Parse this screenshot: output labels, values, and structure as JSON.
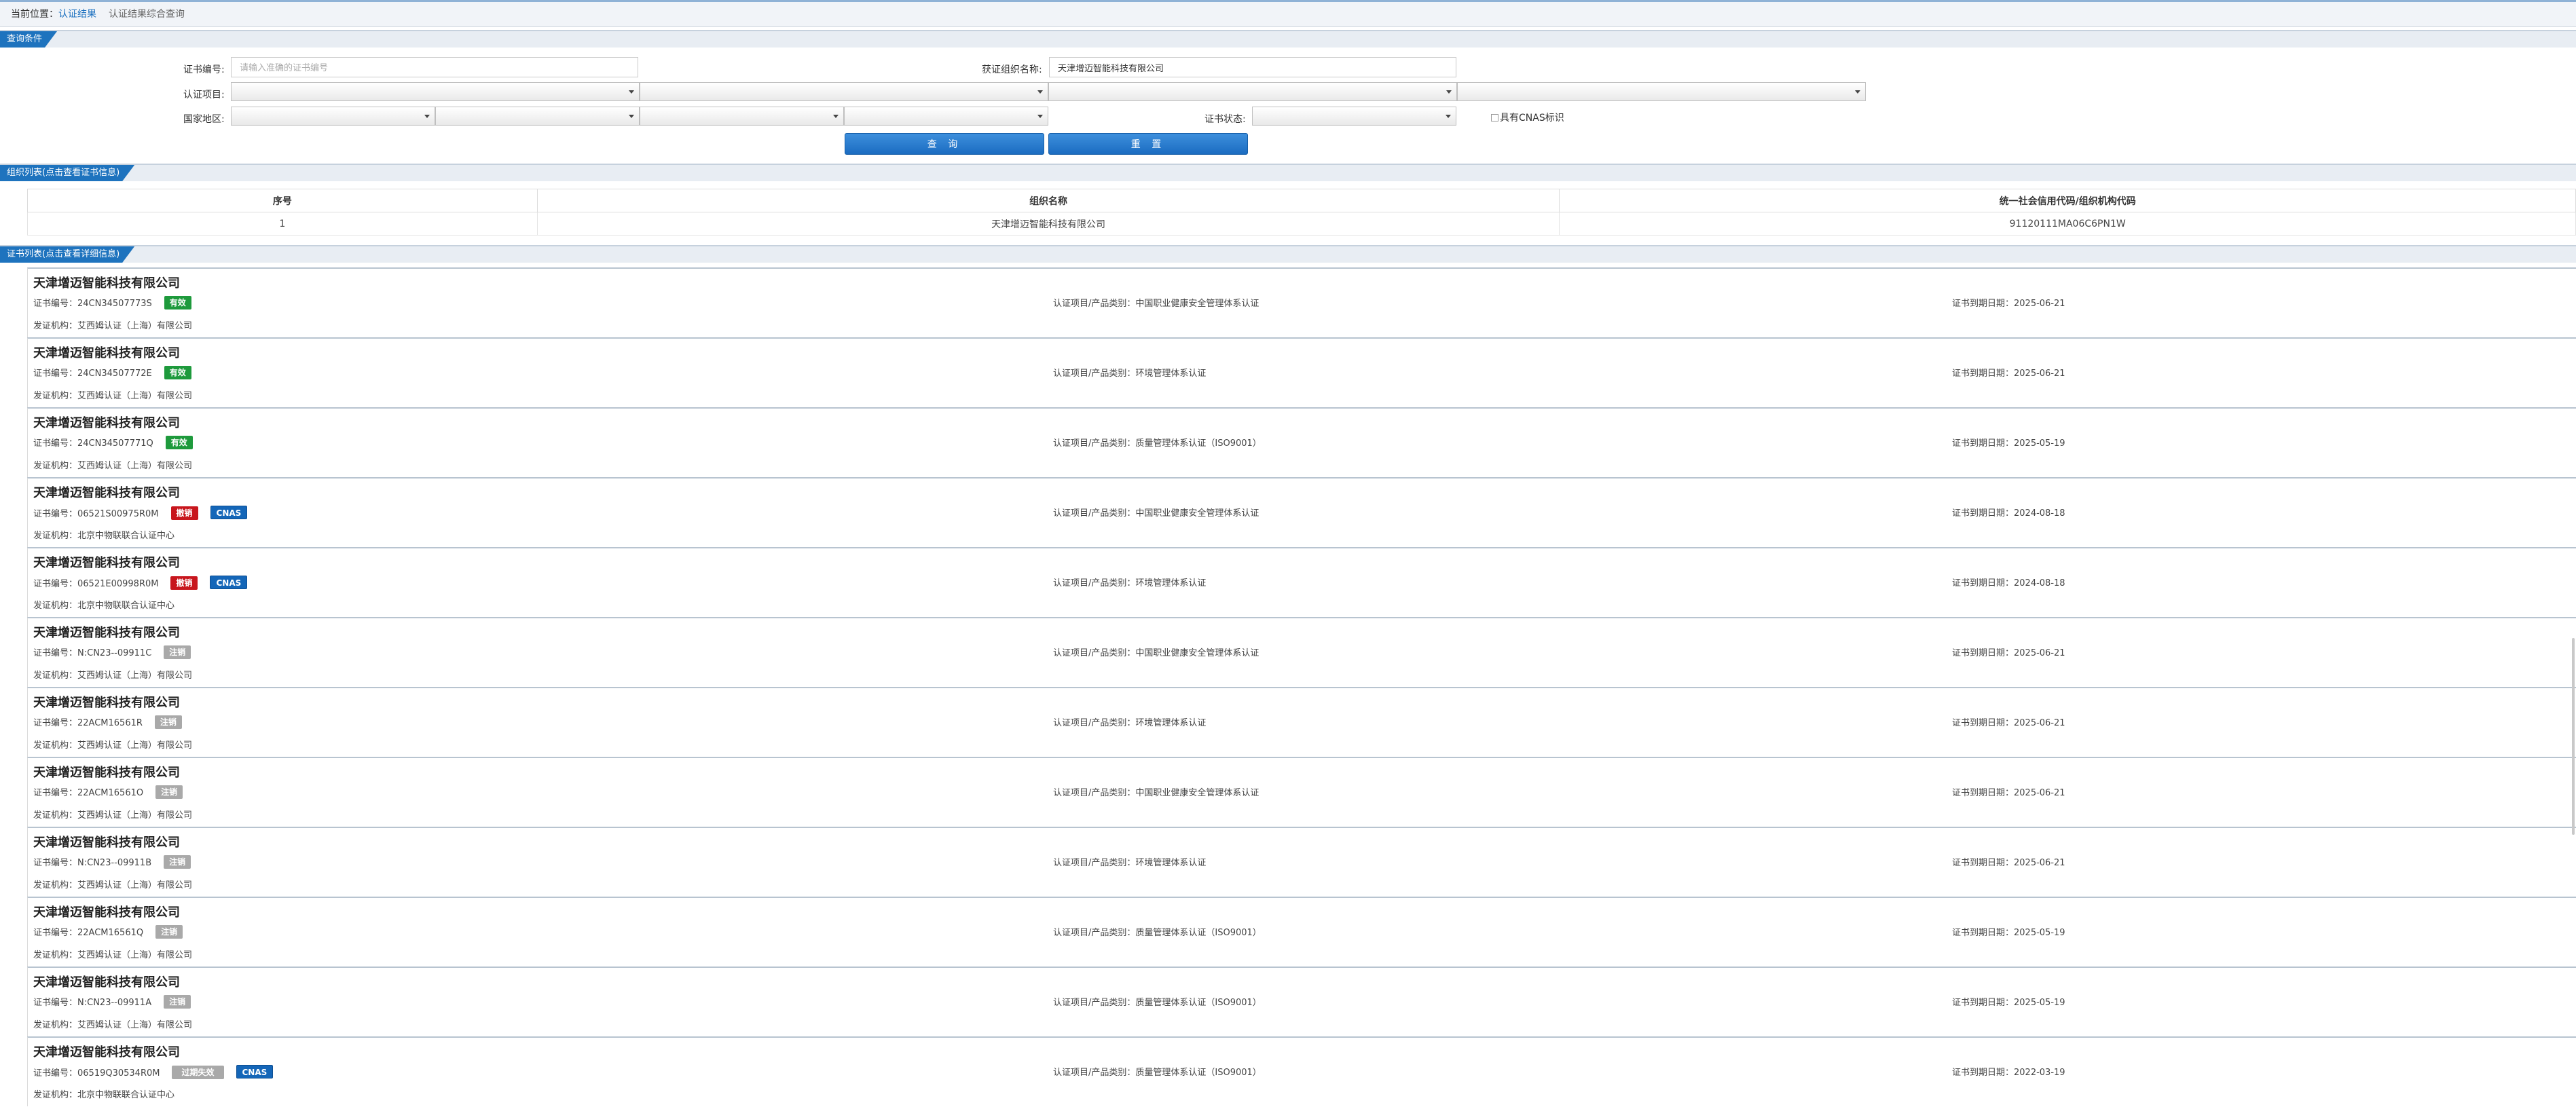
{
  "breadcrumb": {
    "prefix": "当前位置：",
    "current": "认证结果",
    "sub": "认证结果综合查询"
  },
  "query_section": {
    "title": "查询条件"
  },
  "form": {
    "cert_no_label": "证书编号:",
    "cert_no_placeholder": "请输入准确的证书编号",
    "org_name_label": "获证组织名称:",
    "org_name_value": "天津增迈智能科技有限公司",
    "project_label": "认证项目:",
    "region_label": "国家地区:",
    "status_label": "证书状态:",
    "cnas_label": "具有CNAS标识"
  },
  "buttons": {
    "search": "查 询",
    "reset": "重 置"
  },
  "org_section": {
    "title": "组织列表(点击查看证书信息)"
  },
  "org_table": {
    "headers": [
      "序号",
      "组织名称",
      "统一社会信用代码/组织机构代码"
    ],
    "rows": [
      [
        "1",
        "天津增迈智能科技有限公司",
        "91120111MA06C6PN1W"
      ]
    ]
  },
  "cert_section": {
    "title": "证书列表(点击查看详细信息)"
  },
  "cert_labels": {
    "no": "证书编号：",
    "issuer": "发证机构：",
    "project": "认证项目/产品类别：",
    "expiry": "证书到期日期："
  },
  "certs": [
    {
      "name": "天津增迈智能科技有限公司",
      "no": "24CN34507773S",
      "status": "有效",
      "status_type": "valid",
      "cnas": "",
      "issuer": "艾西姆认证（上海）有限公司",
      "project": "中国职业健康安全管理体系认证",
      "expiry": "2025-06-21"
    },
    {
      "name": "天津增迈智能科技有限公司",
      "no": "24CN34507772E",
      "status": "有效",
      "status_type": "valid",
      "cnas": "",
      "issuer": "艾西姆认证（上海）有限公司",
      "project": "环境管理体系认证",
      "expiry": "2025-06-21"
    },
    {
      "name": "天津增迈智能科技有限公司",
      "no": "24CN34507771Q",
      "status": "有效",
      "status_type": "valid",
      "cnas": "",
      "issuer": "艾西姆认证（上海）有限公司",
      "project": "质量管理体系认证（ISO9001）",
      "expiry": "2025-05-19"
    },
    {
      "name": "天津增迈智能科技有限公司",
      "no": "06521S00975R0M",
      "status": "撤销",
      "status_type": "revoked",
      "cnas": "CNAS",
      "issuer": "北京中物联联合认证中心",
      "project": "中国职业健康安全管理体系认证",
      "expiry": "2024-08-18"
    },
    {
      "name": "天津增迈智能科技有限公司",
      "no": "06521E00998R0M",
      "status": "撤销",
      "status_type": "revoked",
      "cnas": "CNAS",
      "issuer": "北京中物联联合认证中心",
      "project": "环境管理体系认证",
      "expiry": "2024-08-18"
    },
    {
      "name": "天津增迈智能科技有限公司",
      "no": "N:CN23--09911C",
      "status": "注销",
      "status_type": "cancel",
      "cnas": "",
      "issuer": "艾西姆认证（上海）有限公司",
      "project": "中国职业健康安全管理体系认证",
      "expiry": "2025-06-21"
    },
    {
      "name": "天津增迈智能科技有限公司",
      "no": "22ACM16561R",
      "status": "注销",
      "status_type": "cancel",
      "cnas": "",
      "issuer": "艾西姆认证（上海）有限公司",
      "project": "环境管理体系认证",
      "expiry": "2025-06-21"
    },
    {
      "name": "天津增迈智能科技有限公司",
      "no": "22ACM16561O",
      "status": "注销",
      "status_type": "cancel",
      "cnas": "",
      "issuer": "艾西姆认证（上海）有限公司",
      "project": "中国职业健康安全管理体系认证",
      "expiry": "2025-06-21"
    },
    {
      "name": "天津增迈智能科技有限公司",
      "no": "N:CN23--09911B",
      "status": "注销",
      "status_type": "cancel",
      "cnas": "",
      "issuer": "艾西姆认证（上海）有限公司",
      "project": "环境管理体系认证",
      "expiry": "2025-06-21"
    },
    {
      "name": "天津增迈智能科技有限公司",
      "no": "22ACM16561Q",
      "status": "注销",
      "status_type": "cancel",
      "cnas": "",
      "issuer": "艾西姆认证（上海）有限公司",
      "project": "质量管理体系认证（ISO9001）",
      "expiry": "2025-05-19"
    },
    {
      "name": "天津增迈智能科技有限公司",
      "no": "N:CN23--09911A",
      "status": "注销",
      "status_type": "cancel",
      "cnas": "",
      "issuer": "艾西姆认证（上海）有限公司",
      "project": "质量管理体系认证（ISO9001）",
      "expiry": "2025-05-19"
    },
    {
      "name": "天津增迈智能科技有限公司",
      "no": "06519Q30534R0M",
      "status": "过期失效",
      "status_type": "expired",
      "cnas": "CNAS",
      "issuer": "北京中物联联合认证中心",
      "project": "质量管理体系认证（ISO9001）",
      "expiry": "2022-03-19"
    }
  ],
  "colors": {
    "accent": "#1e73be",
    "valid": "#1e9a3c",
    "revoked": "#c8161d",
    "cancel": "#a9a9a9",
    "cnas": "#1466b8"
  }
}
